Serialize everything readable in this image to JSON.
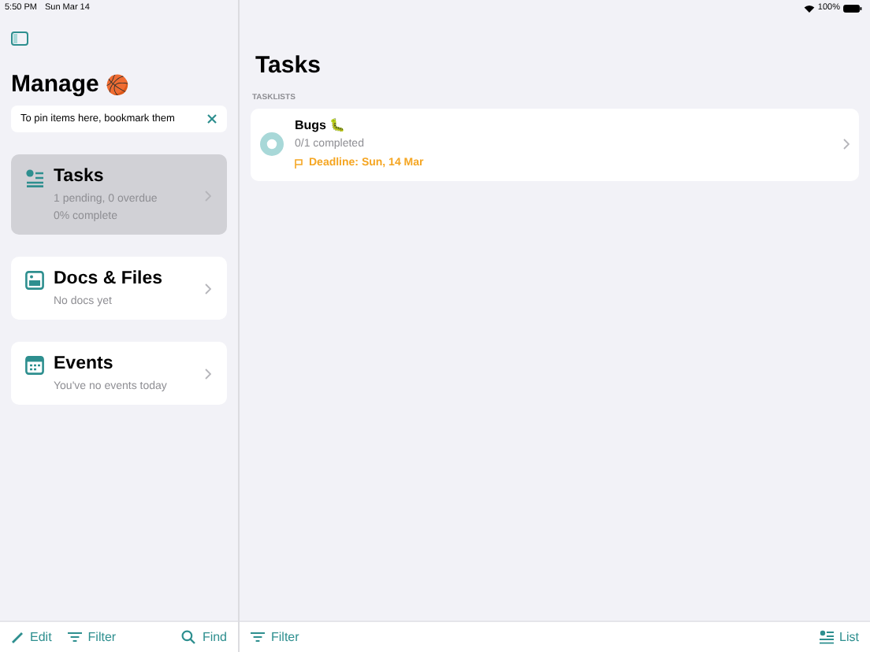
{
  "status_bar": {
    "time": "5:50 PM",
    "date": "Sun Mar 14",
    "battery": "100%"
  },
  "sidebar": {
    "title": "Manage",
    "title_emoji": "🏀",
    "pin_hint": "To pin items here, bookmark them",
    "items": [
      {
        "kind": "tasks",
        "title": "Tasks",
        "lines": [
          "1 pending, 0 overdue",
          "0% complete"
        ],
        "selected": true
      },
      {
        "kind": "docs",
        "title": "Docs & Files",
        "lines": [
          "No docs yet"
        ],
        "selected": false
      },
      {
        "kind": "events",
        "title": "Events",
        "lines": [
          "You've no events today"
        ],
        "selected": false
      }
    ],
    "toolbar": [
      {
        "kind": "edit",
        "label": "Edit"
      },
      {
        "kind": "filter",
        "label": "Filter"
      },
      {
        "kind": "find",
        "label": "Find"
      }
    ]
  },
  "detail": {
    "title": "Tasks",
    "section": "TASKLISTS",
    "tasklists": [
      {
        "name": "Bugs",
        "emoji": "🐛",
        "progress": "0/1 completed",
        "deadline": "Deadline: Sun, 14 Mar"
      }
    ],
    "toolbar": [
      {
        "kind": "filter",
        "label": "Filter"
      },
      {
        "kind": "list",
        "label": "List"
      }
    ]
  }
}
